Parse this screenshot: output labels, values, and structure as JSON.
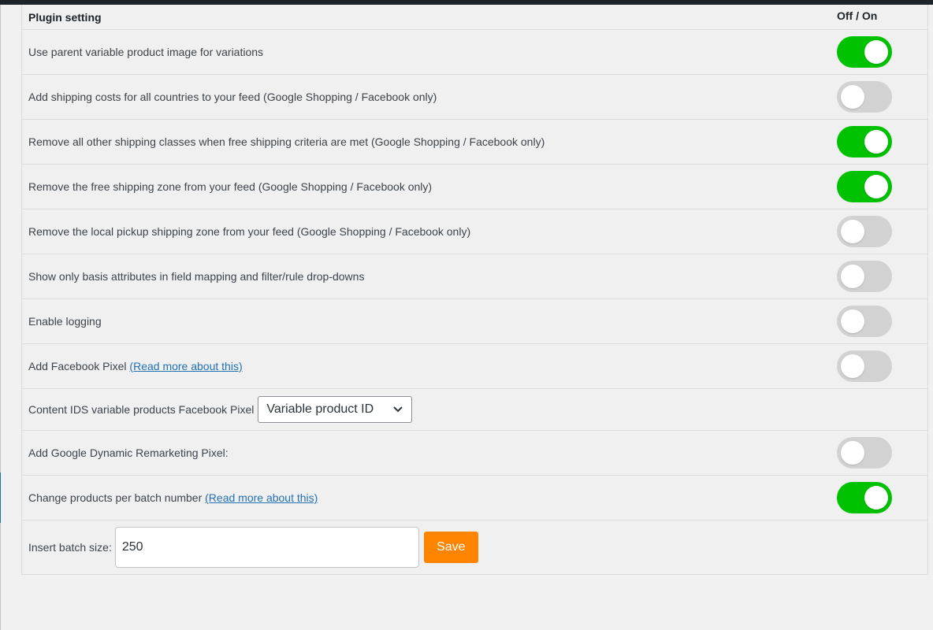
{
  "header": {
    "title": "Plugin setting",
    "toggle_col": "Off / On"
  },
  "settings": [
    {
      "label": "Use parent variable product image for variations",
      "on": true
    },
    {
      "label": "Add shipping costs for all countries to your feed (Google Shopping / Facebook only)",
      "on": false
    },
    {
      "label": "Remove all other shipping classes when free shipping criteria are met (Google Shopping / Facebook only)",
      "on": true
    },
    {
      "label": "Remove the free shipping zone from your feed (Google Shopping / Facebook only)",
      "on": true
    },
    {
      "label": "Remove the local pickup shipping zone from your feed (Google Shopping / Facebook only)",
      "on": false
    },
    {
      "label": "Show only basis attributes in field mapping and filter/rule drop-downs",
      "on": false
    },
    {
      "label": "Enable logging",
      "on": false
    },
    {
      "label": "Add Facebook Pixel",
      "link": "(Read more about this)",
      "on": false
    },
    {
      "label": "Content IDS variable products Facebook Pixel",
      "select_value": "Variable product ID"
    },
    {
      "label": "Add Google Dynamic Remarketing Pixel:",
      "on": false
    },
    {
      "label": "Change products per batch number",
      "link": "(Read more about this)",
      "on": true
    }
  ],
  "batch": {
    "label": "Insert batch size:",
    "value": "250",
    "save_label": "Save"
  },
  "colors": {
    "toggle_on": "#00c200",
    "toggle_off": "#d2d2d2",
    "save_button": "#ff8500",
    "link": "#2271b1"
  },
  "icons": {
    "select_arrow": "chevron-down-icon"
  }
}
